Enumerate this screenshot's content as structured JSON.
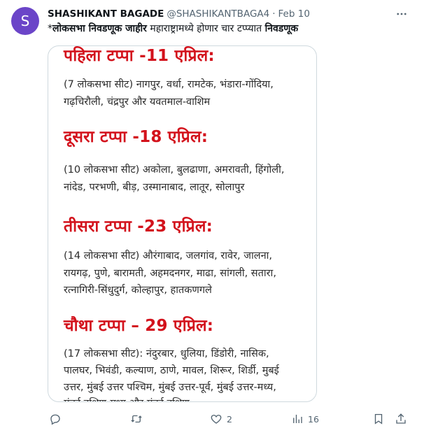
{
  "author": {
    "avatar_letter": "S",
    "avatar_color": "#6b45c8",
    "display_name": "SHASHIKANT BAGADE",
    "handle": "@SHASHIKANTBAGA4",
    "separator": "·",
    "date": "Feb 10"
  },
  "tweet": {
    "text_prefix": "*",
    "text_bold_1": "लोकसभा निवडणूक जाहीर",
    "text_middle": " महाराष्ट्रामध्ये होणार चार टप्प्यात ",
    "text_bold_2": "निवडणूक"
  },
  "image": {
    "phases": [
      {
        "title": "पहिला टप्पा -11 एप्रिल:",
        "lines": [
          "(7 लोकसभा सीट) नागपुर, वर्धा, रामटेक, भंडारा-गोंदिया,",
          "गढ़चिरौली, चंद्रपुर और यवतमाल-वाशिम"
        ]
      },
      {
        "title": "दूसरा टप्पा -18 एप्रिल:",
        "lines": [
          "(10 लोकसभा सीट) अकोला, बुलढाणा, अमरावती, हिंगोली,",
          "नांदेड, परभणी, बीड़, उस्मानाबाद, लातूर, सोलापुर"
        ]
      },
      {
        "title": "तीसरा टप्पा -23 एप्रिल:",
        "lines": [
          "(14 लोकसभा सीट) औरंगाबाद, जलगांव, रावेर, जालना,",
          "रायगढ़, पुणे, बारामती, अहमदनगर, माढा, सांगली, सतारा,",
          "रत्नागिरी-सिंधुदुर्ग, कोल्हापुर, हातकणगले"
        ]
      },
      {
        "title": "चौथा टप्पा – 29 एप्रिल:",
        "lines": [
          "(17 लोकसभा सीट): नंदुरबार, धुलिया, डिंडोरी, नासिक,",
          "पालघर, भिवंडी, कल्याण, ठाणे, मावल, शिरूर, शिर्डी, मुबई",
          "उत्तर, मुंबई उत्तर पश्चिम, मुंबई उत्तर-पूर्व, मुंबई उत्तर-मध्य,",
          "मुंबई दक्षिण-मध्य और मुंबई दक्षिण"
        ]
      }
    ],
    "title_color": "#d3121c"
  },
  "actions": {
    "reply_icon": "reply-icon",
    "retweet_icon": "retweet-icon",
    "like_icon": "like-icon",
    "like_count": "2",
    "views_icon": "views-icon",
    "views_count": "16",
    "bookmark_icon": "bookmark-icon",
    "share_icon": "share-icon"
  }
}
